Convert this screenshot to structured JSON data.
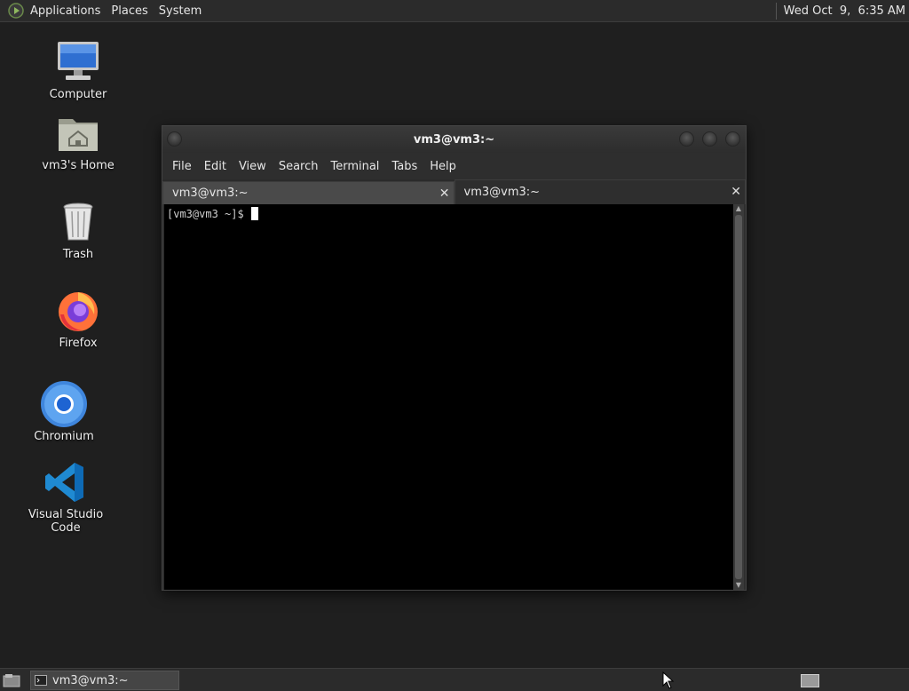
{
  "top_panel": {
    "menus": [
      "Applications",
      "Places",
      "System"
    ],
    "clock": "Wed Oct  9,  6:35 AM"
  },
  "desktop": {
    "icons": [
      {
        "label": "Computer",
        "icon": "computer-icon"
      },
      {
        "label": "vm3's Home",
        "icon": "home-folder-icon"
      },
      {
        "label": "Trash",
        "icon": "trash-icon"
      },
      {
        "label": "Firefox",
        "icon": "firefox-icon"
      },
      {
        "label": "Chromium",
        "icon": "chromium-icon"
      },
      {
        "label": "Visual Studio Code",
        "icon": "vscode-icon"
      }
    ]
  },
  "terminal": {
    "title": "vm3@vm3:~",
    "menu": [
      "File",
      "Edit",
      "View",
      "Search",
      "Terminal",
      "Tabs",
      "Help"
    ],
    "tabs": [
      {
        "label": "vm3@vm3:~",
        "active": false
      },
      {
        "label": "vm3@vm3:~",
        "active": true
      }
    ],
    "prompt": "[vm3@vm3 ~]$"
  },
  "bottom_panel": {
    "taskbar_item": "vm3@vm3:~"
  },
  "colors": {
    "desktop_bg": "#1f1f1f",
    "panel_bg": "#2b2b2b",
    "terminal_bg": "#000000"
  }
}
